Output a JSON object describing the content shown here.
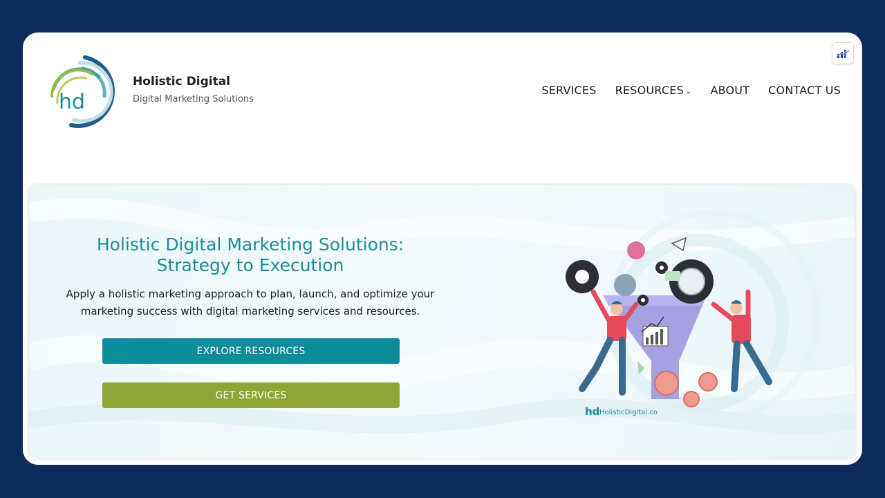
{
  "brand": {
    "name": "Holistic Digital",
    "tagline": "Digital Marketing Solutions",
    "logo_text": "hd"
  },
  "nav": {
    "items": [
      {
        "label": "SERVICES"
      },
      {
        "label": "RESOURCES",
        "has_dropdown": true
      },
      {
        "label": "ABOUT"
      },
      {
        "label": "CONTACT US"
      }
    ]
  },
  "toolbar": {
    "icon": "chart-bars-icon"
  },
  "hero": {
    "title_line1": "Holistic Digital Marketing Solutions:",
    "title_line2": "Strategy to Execution",
    "description_line1": "Apply a holistic marketing approach to plan, launch, and optimize your",
    "description_line2": "marketing success with digital marketing services and resources.",
    "primary_button": "EXPLORE RESOURCES",
    "secondary_button": "GET SERVICES",
    "illustration_watermark_logo": "hd",
    "illustration_watermark_text": "HolisticDigital.co"
  },
  "colors": {
    "page_bg": "#0f2a5c",
    "title_teal": "#1a8e98",
    "explore_button": "#0d8c9c",
    "services_button": "#8ea534"
  }
}
